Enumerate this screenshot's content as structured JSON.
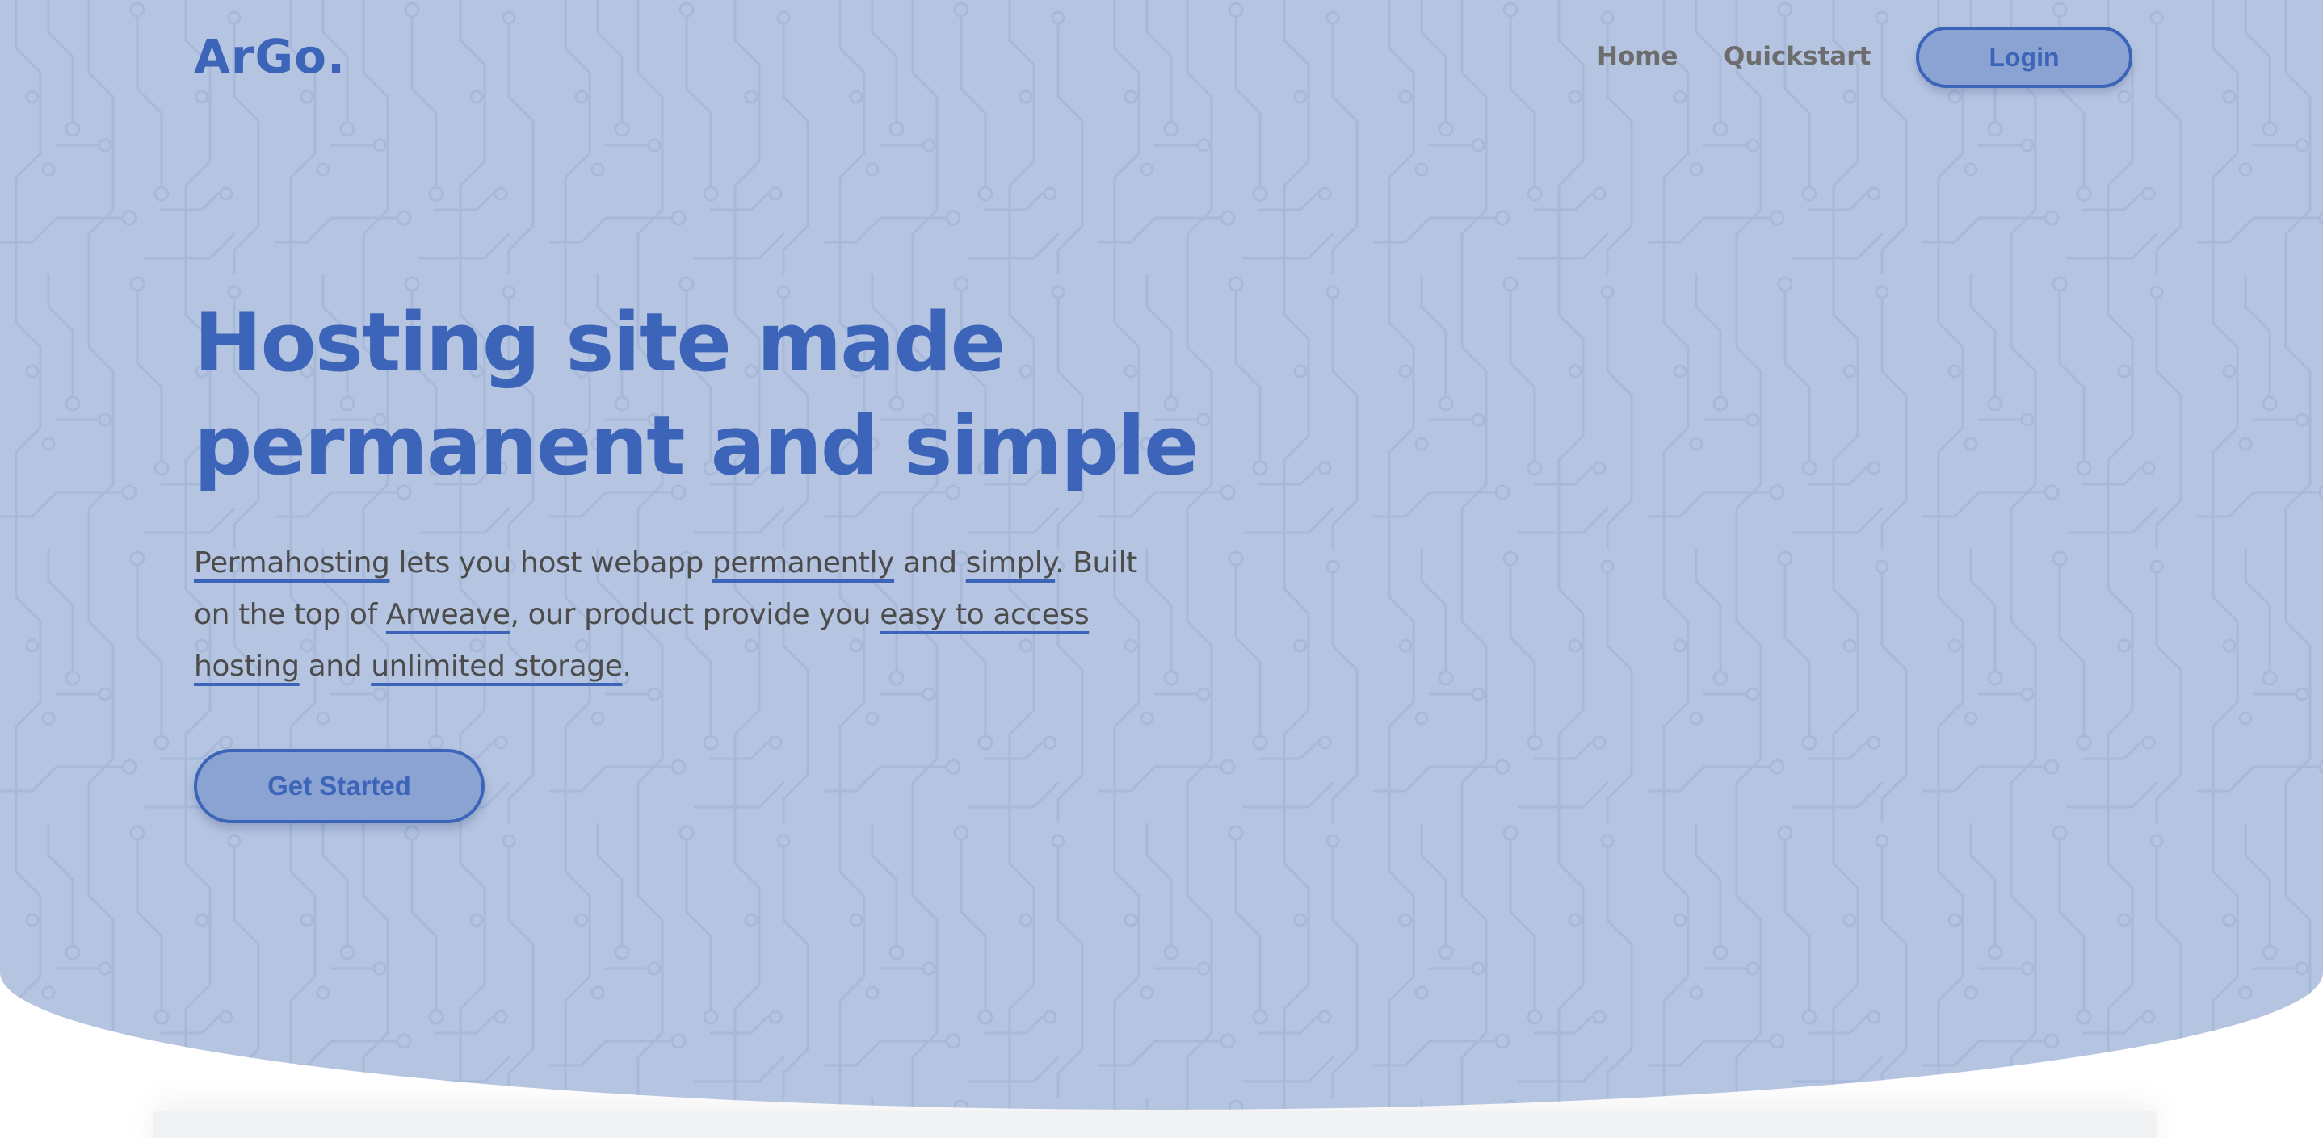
{
  "brand": {
    "logo": "ArGo."
  },
  "nav": {
    "links": [
      {
        "label": "Home"
      },
      {
        "label": "Quickstart"
      }
    ],
    "login_label": "Login"
  },
  "hero": {
    "title_line1": "Hosting site made",
    "title_line2": "permanent and simple",
    "description": [
      {
        "text": "Permahosting",
        "underlined": true
      },
      {
        "text": " lets you host webapp ",
        "underlined": false
      },
      {
        "text": "permanently",
        "underlined": true
      },
      {
        "text": " and ",
        "underlined": false
      },
      {
        "text": "simply",
        "underlined": true
      },
      {
        "text": ". Built on the top of ",
        "underlined": false
      },
      {
        "text": "Arweave",
        "underlined": true
      },
      {
        "text": ", our product provide you ",
        "underlined": false
      },
      {
        "text": "easy to access hosting",
        "underlined": true
      },
      {
        "text": " and ",
        "underlined": false
      },
      {
        "text": "unlimited storage",
        "underlined": true
      },
      {
        "text": ".",
        "underlined": false
      }
    ],
    "cta_label": "Get Started"
  },
  "theme": {
    "accent": "#3c64b8",
    "hero_background": "#b5c5e1",
    "button_fill": "#8aa3d3",
    "text_muted": "#4c4c4c",
    "nav_text": "#6d6d6d",
    "background_pattern": "circuit-board-pattern"
  }
}
